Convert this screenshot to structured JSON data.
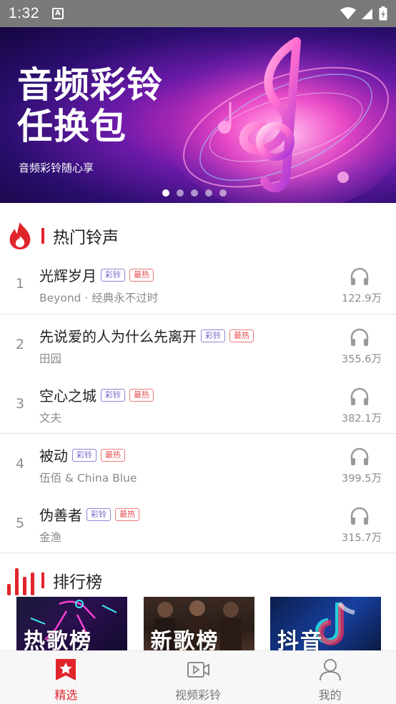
{
  "status_bar": {
    "time": "1:32"
  },
  "banner": {
    "title_line1": "音频彩铃",
    "title_line2": "任换包",
    "subtitle": "音频彩铃随心享",
    "active_slide": 1,
    "slide_count": 5
  },
  "hot_section": {
    "title": "热门铃声"
  },
  "songs": [
    {
      "rank": "1",
      "title": "光辉岁月",
      "artist": "Beyond · 经典永不过时",
      "plays": "122.9万",
      "tag_cl": "彩铃",
      "tag_hot": "最热"
    },
    {
      "rank": "2",
      "title": "先说爱的人为什么先离开",
      "artist": "田园",
      "plays": "355.6万",
      "tag_cl": "彩铃",
      "tag_hot": "最热"
    },
    {
      "rank": "3",
      "title": "空心之城",
      "artist": "文夫",
      "plays": "382.1万",
      "tag_cl": "彩铃",
      "tag_hot": "最热"
    },
    {
      "rank": "4",
      "title": "被动",
      "artist": "伍佰 & China Blue",
      "plays": "399.5万",
      "tag_cl": "彩铃",
      "tag_hot": "最热"
    },
    {
      "rank": "5",
      "title": "伪善者",
      "artist": "金渔",
      "plays": "315.7万",
      "tag_cl": "彩铃",
      "tag_hot": "最热"
    }
  ],
  "ranking_section": {
    "title": "排行榜",
    "cards": [
      {
        "label": "热歌榜"
      },
      {
        "label": "新歌榜"
      },
      {
        "label": "抖音"
      }
    ]
  },
  "bottom_nav": {
    "items": [
      {
        "label": "精选",
        "icon": "star-bookmark-icon",
        "active": true
      },
      {
        "label": "视频彩铃",
        "icon": "video-ringtone-icon",
        "active": false
      },
      {
        "label": "我的",
        "icon": "user-icon",
        "active": false
      }
    ]
  },
  "colors": {
    "accent": "#e0242b",
    "tag_cl": "#6f64c9",
    "tag_hot": "#e74a4a",
    "status_bar": "#7a7a7a"
  }
}
